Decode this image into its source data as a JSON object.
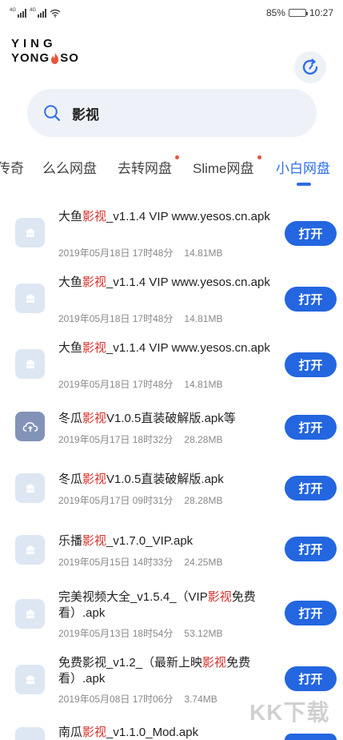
{
  "status_bar": {
    "signal1_tag": "4G",
    "signal2_tag": "4G",
    "battery_text": "85%",
    "battery_level": 0.85,
    "time": "10:27"
  },
  "logo": {
    "line1": "YING",
    "line2_a": "YONG",
    "line2_b": "SO",
    "flame_color": "#e8533a"
  },
  "search": {
    "query": "影视",
    "icon": "search-icon"
  },
  "tabs": [
    {
      "label": "传奇",
      "dot": false,
      "active": false
    },
    {
      "label": "么么网盘",
      "dot": false,
      "active": false
    },
    {
      "label": "去转网盘",
      "dot": true,
      "active": false
    },
    {
      "label": "Slime网盘",
      "dot": true,
      "active": false
    },
    {
      "label": "小白网盘",
      "dot": false,
      "active": true
    }
  ],
  "accent_color": "#2f6fe6",
  "highlight_color": "#d6302a",
  "open_label": "打开",
  "results": [
    {
      "icon": "file-icon",
      "title_pre": "大鱼",
      "title_hl": "影视",
      "title_post": "_v1.1.4 VIP www.yesos.cn.apk",
      "date": "2019年05月18日 17时48分",
      "size": "14.81MB"
    },
    {
      "icon": "file-icon",
      "title_pre": "大鱼",
      "title_hl": "影视",
      "title_post": "_v1.1.4 VIP www.yesos.cn.apk",
      "date": "2019年05月18日 17时48分",
      "size": "14.81MB"
    },
    {
      "icon": "file-icon",
      "title_pre": "大鱼",
      "title_hl": "影视",
      "title_post": "_v1.1.4 VIP www.yesos.cn.apk",
      "date": "2019年05月18日 17时48分",
      "size": "14.81MB"
    },
    {
      "icon": "cloud-icon",
      "title_pre": "冬瓜",
      "title_hl": "影视",
      "title_post": "V1.0.5直装破解版.apk等",
      "date": "2019年05月17日 18时32分",
      "size": "28.28MB"
    },
    {
      "icon": "file-icon",
      "title_pre": "冬瓜",
      "title_hl": "影视",
      "title_post": "V1.0.5直装破解版.apk",
      "date": "2019年05月17日 09时31分",
      "size": "28.28MB"
    },
    {
      "icon": "file-icon",
      "title_pre": "乐播",
      "title_hl": "影视",
      "title_post": "_v1.7.0_VIP.apk",
      "date": "2019年05月15日 14时33分",
      "size": "24.25MB"
    },
    {
      "icon": "file-icon",
      "title_pre": "完美视频大全_v1.5.4_（VIP",
      "title_hl": "影视",
      "title_post": "免费看）.apk",
      "date": "2019年05月13日 18时54分",
      "size": "53.12MB"
    },
    {
      "icon": "file-icon",
      "title_pre": "免费影视_v1.2_（最新上映",
      "title_hl": "影视",
      "title_post": "免费看）.apk",
      "date": "2019年05月08日 17时06分",
      "size": "3.74MB"
    },
    {
      "icon": "file-icon",
      "title_pre": "南瓜",
      "title_hl": "影视",
      "title_post": "_v1.1.0_Mod.apk",
      "date": "",
      "size": ""
    }
  ],
  "watermark": "KK下载"
}
